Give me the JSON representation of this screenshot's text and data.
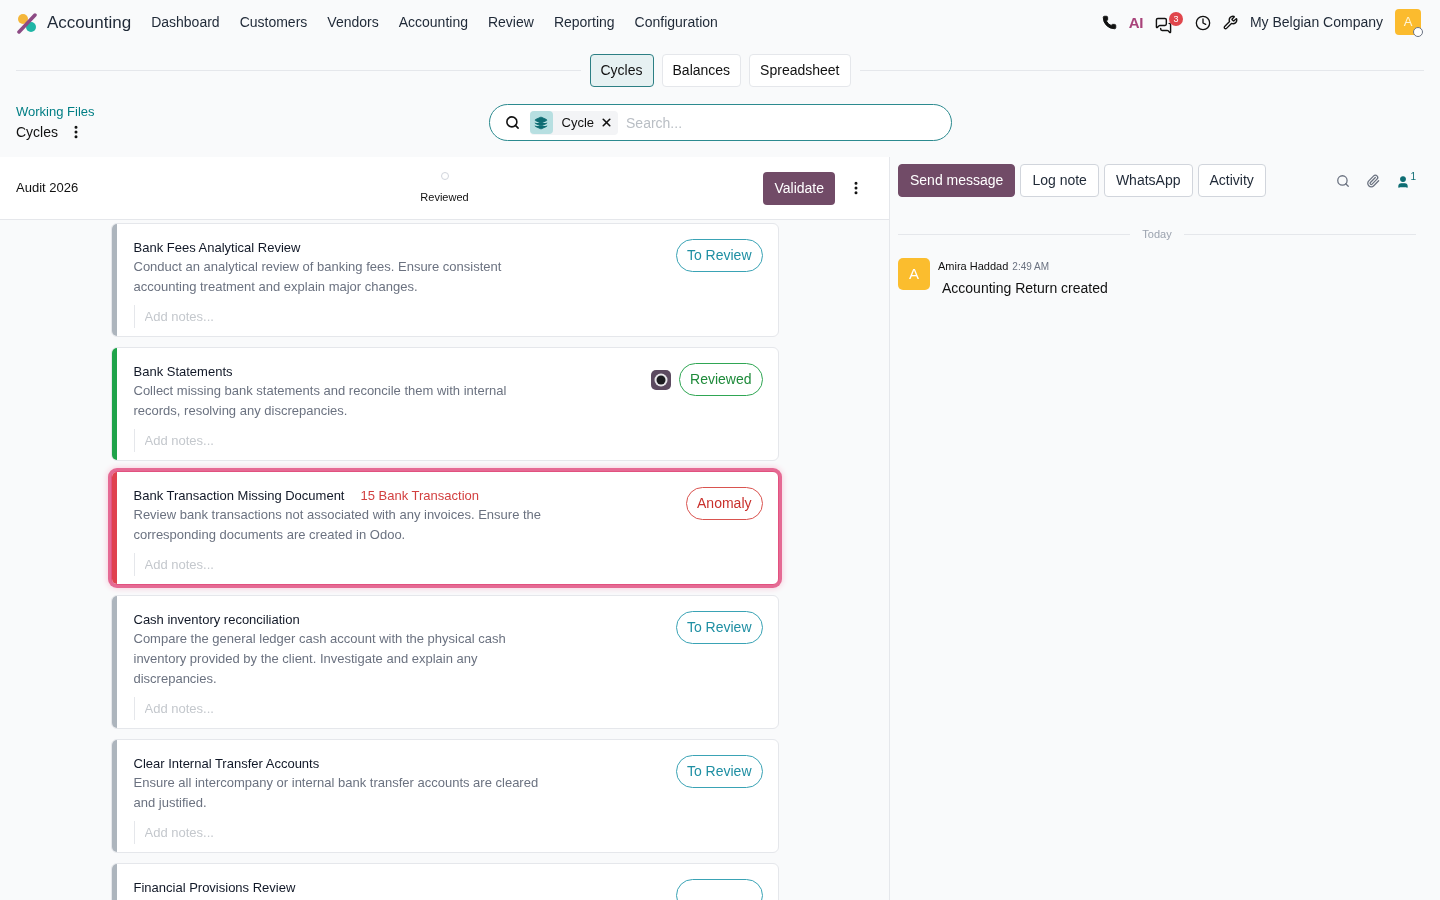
{
  "navbar": {
    "app_name": "Accounting",
    "menu": [
      "Dashboard",
      "Customers",
      "Vendors",
      "Accounting",
      "Review",
      "Reporting",
      "Configuration"
    ],
    "ai_label": "AI",
    "unread_count": "3",
    "company": "My Belgian Company",
    "user_initial": "A"
  },
  "view_tabs": [
    {
      "label": "Cycles",
      "selected": true
    },
    {
      "label": "Balances",
      "selected": false
    },
    {
      "label": "Spreadsheet",
      "selected": false
    }
  ],
  "breadcrumb": {
    "parent": "Working Files",
    "current": "Cycles"
  },
  "search": {
    "facet": "Cycle",
    "placeholder": "Search..."
  },
  "cycle": {
    "name": "Audit 2026",
    "stage": "Reviewed",
    "validate": "Validate"
  },
  "tasks": [
    {
      "title": "Bank Fees Analytical Review",
      "description": "Conduct an analytical review of banking fees. Ensure consistent accounting treatment and explain major changes.",
      "notes_placeholder": "Add notes...",
      "status": "To Review",
      "kind": "to_review",
      "assigned": false,
      "selected": false
    },
    {
      "title": "Bank Statements",
      "description": "Collect missing bank statements and reconcile them with internal records, resolving any discrepancies.",
      "notes_placeholder": "Add notes...",
      "status": "Reviewed",
      "kind": "reviewed",
      "assigned": true,
      "selected": false
    },
    {
      "title": "Bank Transaction Missing Document",
      "tag": "15 Bank Transaction",
      "description": "Review bank transactions not associated with any invoices. Ensure the corresponding documents are created in Odoo.",
      "notes_placeholder": "Add notes...",
      "status": "Anomaly",
      "kind": "anomaly",
      "assigned": false,
      "selected": true
    },
    {
      "title": "Cash inventory reconciliation",
      "description": "Compare the general ledger cash account with the physical cash inventory provided by the client. Investigate and explain any discrepancies.",
      "notes_placeholder": "Add notes...",
      "status": "To Review",
      "kind": "to_review",
      "assigned": false,
      "selected": false
    },
    {
      "title": "Clear Internal Transfer Accounts",
      "description": "Ensure all intercompany or internal bank transfer accounts are cleared and justified.",
      "notes_placeholder": "Add notes...",
      "status": "To Review",
      "kind": "to_review",
      "assigned": false,
      "selected": false
    },
    {
      "title": "Financial Provisions Review",
      "kind": "to_review",
      "assigned": false,
      "selected": false
    }
  ],
  "chatter": {
    "actions": [
      {
        "label": "Send message",
        "kind": "primary"
      },
      {
        "label": "Log note",
        "kind": "secondary"
      },
      {
        "label": "WhatsApp",
        "kind": "secondary"
      },
      {
        "label": "Activity",
        "kind": "secondary"
      }
    ],
    "follower_count": "1",
    "date_divider": "Today",
    "messages": [
      {
        "avatar_initial": "A",
        "author": "Amira Haddad",
        "time": "2:49 AM",
        "body": "Accounting Return created"
      }
    ]
  }
}
